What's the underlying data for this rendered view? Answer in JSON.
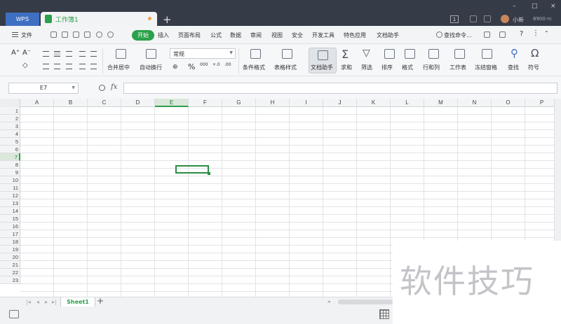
{
  "titlebar": {
    "app_label": "WPS",
    "doc_tab": "工作簿1",
    "new_tab": "+",
    "badge_count": "1",
    "user_name": "小新",
    "account": "8900-rc",
    "window_controls": [
      "–",
      "□",
      "×"
    ]
  },
  "menubar": {
    "file_label": "文件",
    "start_tab": "开始",
    "tabs": [
      "插入",
      "页面布局",
      "公式",
      "数据",
      "审阅",
      "视图",
      "安全",
      "开发工具",
      "特色应用",
      "文档助手"
    ],
    "search_label": "查找命令..."
  },
  "ribbon": {
    "number_format": "常规",
    "buttons": [
      "合并居中",
      "自动换行",
      "条件格式",
      "表格样式",
      "文档助手",
      "求和",
      "筛选",
      "排序",
      "格式",
      "行和列",
      "工作表",
      "冻结窗格",
      "查找",
      "符号"
    ],
    "percent_symbol": "%",
    "thousands_symbol": "000",
    "dec_increase": "+.0",
    "dec_decrease": ".00",
    "sum_symbol": "Σ",
    "symbol_glyph": "Ω"
  },
  "formula_bar": {
    "name_box": "E7",
    "fx_label": "fx",
    "formula": ""
  },
  "grid": {
    "columns": [
      "A",
      "B",
      "C",
      "D",
      "E",
      "F",
      "G",
      "H",
      "I",
      "J",
      "K",
      "L",
      "M",
      "N",
      "O",
      "P"
    ],
    "rows": [
      "1",
      "2",
      "3",
      "4",
      "5",
      "6",
      "7",
      "8",
      "9",
      "10",
      "11",
      "12",
      "13",
      "14",
      "15",
      "16",
      "17",
      "18",
      "19",
      "20",
      "21",
      "22",
      "23"
    ],
    "selected_column": "E",
    "selected_row": "7"
  },
  "sheets": {
    "tab": "Sheet1",
    "add_symbol": "+"
  },
  "watermark": "软件技巧",
  "colors": {
    "accent": "#2aa14a",
    "titlebar": "#353b47",
    "active_cell_border": "#2a8c44"
  }
}
